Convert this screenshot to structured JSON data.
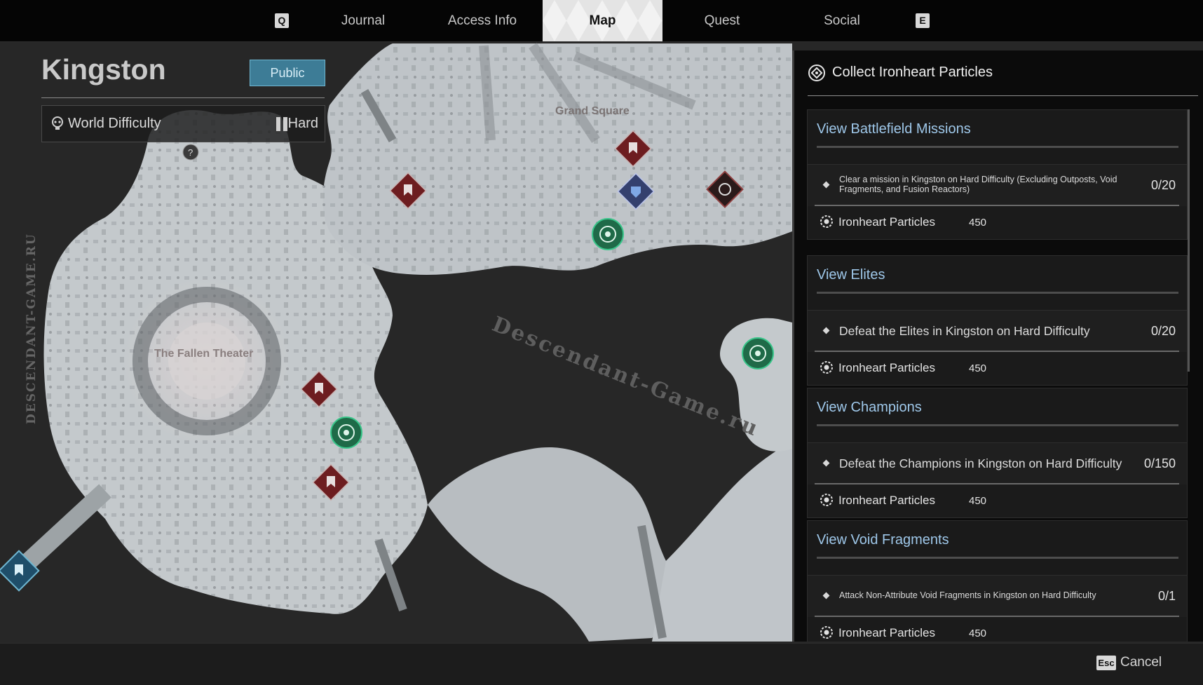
{
  "nav": {
    "prev_key": "Q",
    "next_key": "E",
    "tabs": [
      {
        "label": "Journal",
        "active": false
      },
      {
        "label": "Access Info",
        "active": false
      },
      {
        "label": "Map",
        "active": true
      },
      {
        "label": "Quest",
        "active": false
      },
      {
        "label": "Social",
        "active": false
      }
    ]
  },
  "region": {
    "name": "Kingston",
    "visibility": "Public",
    "difficulty_label": "World Difficulty",
    "difficulty_value": "Hard",
    "difficulty_icon": "skull-icon"
  },
  "map": {
    "locations": {
      "grand_square": "Grand Square",
      "fallen_theater": "The Fallen Theater"
    },
    "watermark_diagonal": "Descendant-Game.ru",
    "watermark_vertical": "DESCENDANT-GAME.RU",
    "colors": {
      "mission_marker": "#7a1f22",
      "objective_marker": "#1f7a55",
      "boss_marker": "#3c3c60",
      "land": "#c9cdd0",
      "void": "#2a2a2a"
    }
  },
  "panel": {
    "title": "Collect Ironheart Particles",
    "title_icon": "target-icon",
    "sections": [
      {
        "title": "View Battlefield Missions",
        "objective": "Clear a mission in Kingston on Hard Difficulty (Excluding Outposts, Void Fragments, and Fusion Reactors)",
        "objective_style": "small",
        "progress": "0/20",
        "reward_name": "Ironheart Particles",
        "reward_amount": "450"
      },
      {
        "title": "View Elites",
        "objective": "Defeat the Elites in Kingston on Hard Difficulty",
        "objective_style": "big",
        "progress": "0/20",
        "reward_name": "Ironheart Particles",
        "reward_amount": "450"
      },
      {
        "title": "View Champions",
        "objective": "Defeat the Champions in Kingston on Hard Difficulty",
        "objective_style": "big",
        "progress": "0/150",
        "reward_name": "Ironheart Particles",
        "reward_amount": "450"
      },
      {
        "title": "View Void Fragments",
        "objective": "Attack Non-Attribute Void Fragments in Kingston on Hard Difficulty",
        "objective_style": "small",
        "progress": "0/1",
        "reward_name": "Ironheart Particles",
        "reward_amount": "450"
      }
    ]
  },
  "footer": {
    "cancel_key": "Esc",
    "cancel_label": "Cancel"
  }
}
